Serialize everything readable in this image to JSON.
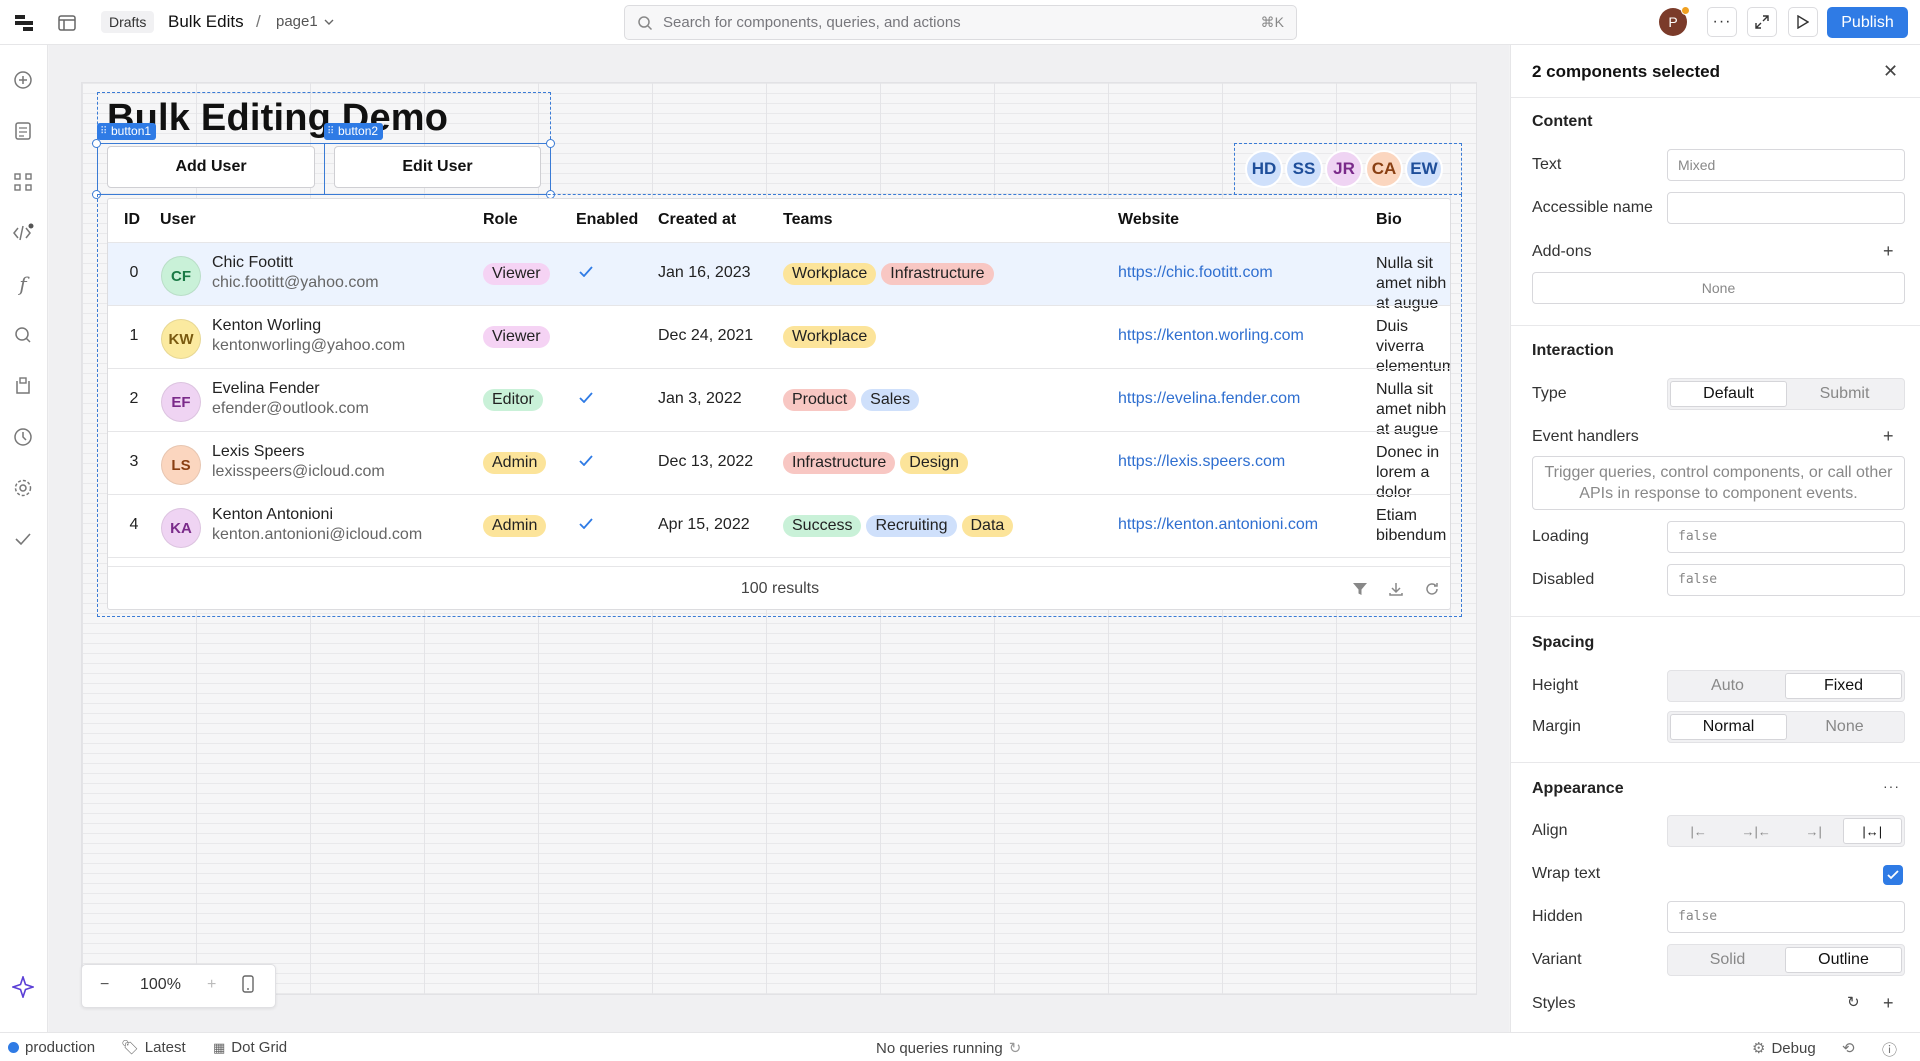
{
  "topbar": {
    "drafts": "Drafts",
    "app_name": "Bulk Edits",
    "separator": "/",
    "page": "page1",
    "search_placeholder": "Search for components, queries, and actions",
    "search_shortcut": "⌘K",
    "user_initial": "P",
    "publish": "Publish"
  },
  "canvas": {
    "title": "Bulk Editing Demo",
    "button1_tag": "button1",
    "button2_tag": "button2",
    "add_user": "Add User",
    "edit_user": "Edit User",
    "avatar_group": [
      {
        "initials": "HD",
        "bg": "#cfe0fb",
        "fg": "#1e4e9a"
      },
      {
        "initials": "SS",
        "bg": "#cfe0fb",
        "fg": "#1e4e9a"
      },
      {
        "initials": "JR",
        "bg": "#efd4f3",
        "fg": "#7a2a8a"
      },
      {
        "initials": "CA",
        "bg": "#fbd6bf",
        "fg": "#8a3f12"
      },
      {
        "initials": "EW",
        "bg": "#cfe0fb",
        "fg": "#1e4e9a"
      }
    ],
    "zoom": "100%"
  },
  "table": {
    "headers": {
      "id": "ID",
      "user": "User",
      "role": "Role",
      "enabled": "Enabled",
      "created": "Created at",
      "teams": "Teams",
      "website": "Website",
      "bio": "Bio"
    },
    "rows": [
      {
        "id": "0",
        "initials": "CF",
        "av_bg": "#c9f1d8",
        "av_fg": "#1a7a45",
        "name": "Chic Footitt",
        "email": "chic.footitt@yahoo.com",
        "role": "Viewer",
        "role_bg": "#f5d3f4",
        "enabled": true,
        "created": "Jan 16, 2023",
        "teams": [
          {
            "t": "Workplace",
            "bg": "#fce49a"
          },
          {
            "t": "Infrastructure",
            "bg": "#f8c7c3"
          }
        ],
        "website": "https://chic.footitt.com",
        "bio": "Nulla sit amet nibh at augue"
      },
      {
        "id": "1",
        "initials": "KW",
        "av_bg": "#fbeaa0",
        "av_fg": "#7a5a10",
        "name": "Kenton Worling",
        "email": "kentonworling@yahoo.com",
        "role": "Viewer",
        "role_bg": "#f5d3f4",
        "enabled": false,
        "created": "Dec 24, 2021",
        "teams": [
          {
            "t": "Workplace",
            "bg": "#fce49a"
          }
        ],
        "website": "https://kenton.worling.com",
        "bio": "Duis viverra elementum"
      },
      {
        "id": "2",
        "initials": "EF",
        "av_bg": "#efd4f3",
        "av_fg": "#7a2a8a",
        "name": "Evelina Fender",
        "email": "efender@outlook.com",
        "role": "Editor",
        "role_bg": "#c9f1d8",
        "enabled": true,
        "created": "Jan 3, 2022",
        "teams": [
          {
            "t": "Product",
            "bg": "#f8c7c3"
          },
          {
            "t": "Sales",
            "bg": "#cfe0fb"
          }
        ],
        "website": "https://evelina.fender.com",
        "bio": "Nulla sit amet nibh at augue"
      },
      {
        "id": "3",
        "initials": "LS",
        "av_bg": "#fbd6bf",
        "av_fg": "#8a3f12",
        "name": "Lexis Speers",
        "email": "lexisspeers@icloud.com",
        "role": "Admin",
        "role_bg": "#fce49a",
        "enabled": true,
        "created": "Dec 13, 2022",
        "teams": [
          {
            "t": "Infrastructure",
            "bg": "#f8c7c3"
          },
          {
            "t": "Design",
            "bg": "#fce49a"
          }
        ],
        "website": "https://lexis.speers.com",
        "bio": "Donec in lorem a dolor"
      },
      {
        "id": "4",
        "initials": "KA",
        "av_bg": "#efd4f3",
        "av_fg": "#7a2a8a",
        "name": "Kenton Antonioni",
        "email": "kenton.antonioni@icloud.com",
        "role": "Admin",
        "role_bg": "#fce49a",
        "enabled": true,
        "created": "Apr 15, 2022",
        "teams": [
          {
            "t": "Success",
            "bg": "#c9f1d8"
          },
          {
            "t": "Recruiting",
            "bg": "#cfe0fb"
          },
          {
            "t": "Data",
            "bg": "#fce49a"
          }
        ],
        "website": "https://kenton.antonioni.com",
        "bio": "Etiam bibendum"
      }
    ],
    "results": "100 results"
  },
  "inspector": {
    "title": "2 components selected",
    "content": "Content",
    "text_label": "Text",
    "text_value": "Mixed",
    "accessible_name": "Accessible name",
    "addons": "Add-ons",
    "addons_value": "None",
    "interaction": "Interaction",
    "type": "Type",
    "type_default": "Default",
    "type_submit": "Submit",
    "event_handlers": "Event handlers",
    "event_note": "Trigger queries, control components, or call other APIs in response to component events.",
    "loading": "Loading",
    "loading_value": "false",
    "disabled": "Disabled",
    "disabled_value": "false",
    "spacing": "Spacing",
    "height": "Height",
    "height_auto": "Auto",
    "height_fixed": "Fixed",
    "margin": "Margin",
    "margin_normal": "Normal",
    "margin_none": "None",
    "appearance": "Appearance",
    "align": "Align",
    "wrap_text": "Wrap text",
    "hidden": "Hidden",
    "hidden_value": "false",
    "variant": "Variant",
    "variant_solid": "Solid",
    "variant_outline": "Outline",
    "styles": "Styles"
  },
  "statusbar": {
    "env": "production",
    "release": "Latest",
    "grid": "Dot Grid",
    "queries": "No queries running",
    "debug": "Debug"
  },
  "colors": {
    "accent": "#2f7be5",
    "env_dot": "#2f7be5"
  }
}
